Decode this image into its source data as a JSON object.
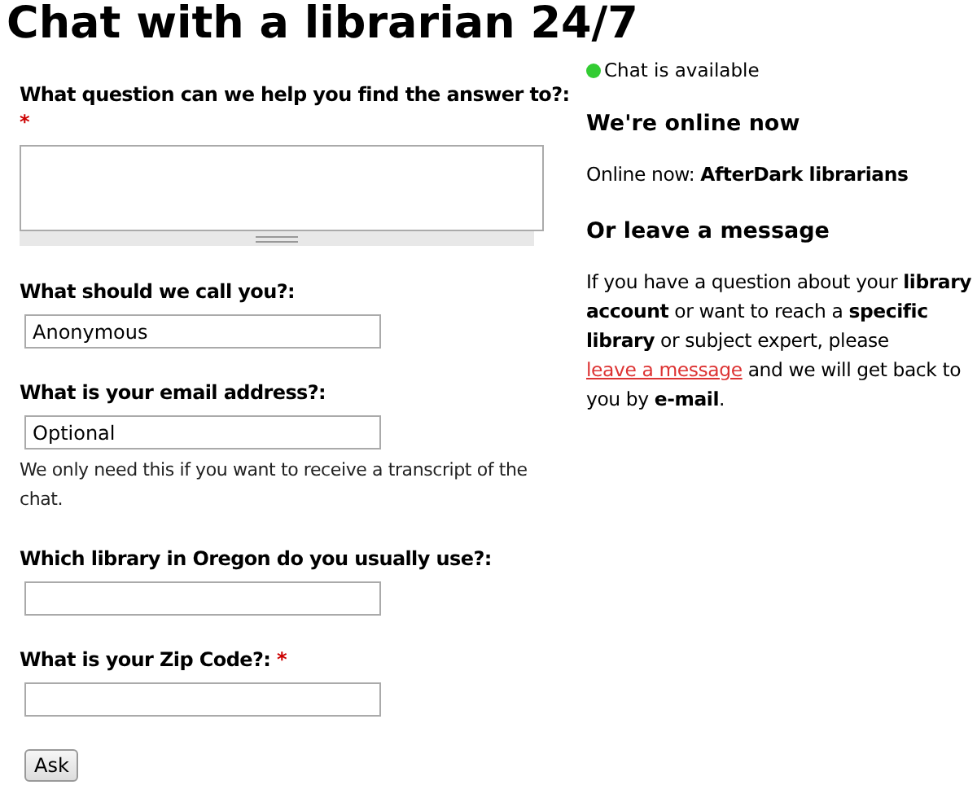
{
  "title": "Chat with a librarian 24/7",
  "form": {
    "fields": [
      {
        "kind": "textarea",
        "label": "What question can we help you find the answer to?:",
        "required": true
      },
      {
        "kind": "text",
        "label": "What should we call you?:",
        "required": false,
        "value": "Anonymous"
      },
      {
        "kind": "text",
        "label": "What is your email address?:",
        "required": false,
        "value": "Optional",
        "help": "We only need this if you want to receive a transcript of the chat."
      },
      {
        "kind": "text",
        "label": "Which library in Oregon do you usually use?:",
        "required": false
      },
      {
        "kind": "text",
        "label": "What is your Zip Code?:",
        "required": true
      }
    ],
    "required_mark": "*",
    "submit": "Ask"
  },
  "status": {
    "text": "Chat is available",
    "available": true
  },
  "online": {
    "heading": "We're online now",
    "text": "Online now: **AfterDark librarians**"
  },
  "message": {
    "heading": "Or leave a message",
    "before": "If you have a question about your **library account** or want to reach a **specific library** or subject expert, please ",
    "link": "leave a message",
    "after": " and we will get back to you by **e-mail**."
  }
}
